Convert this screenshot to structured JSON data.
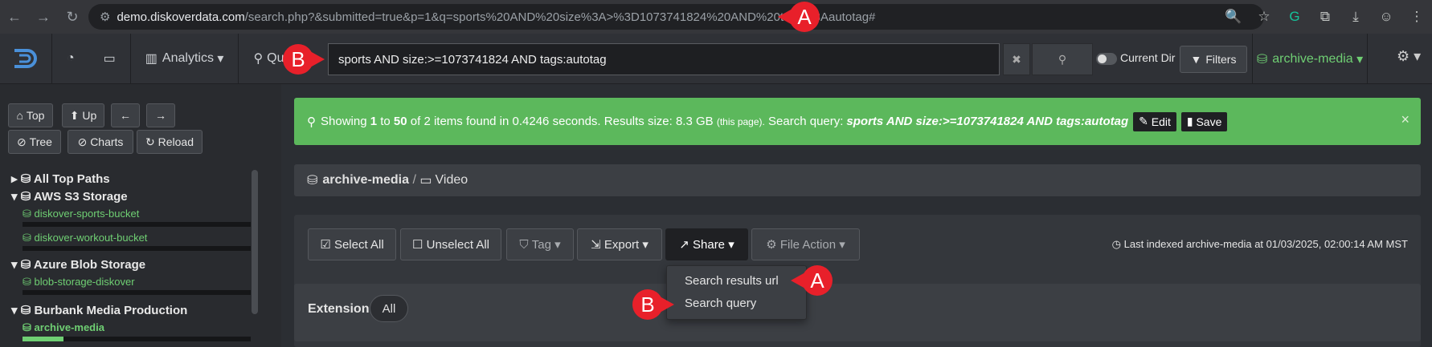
{
  "browser": {
    "url_domain": "demo.diskoverdata.com",
    "url_rest": "/search.php?&submitted=true&p=1&q=sports%20AND%20size%3A>%3D1073741824%20AND%20tags%3Aautotag#"
  },
  "callouts": {
    "a": "A",
    "b": "B"
  },
  "appnav": {
    "analytics": "Analytics",
    "quick_search": "Qu",
    "search_value": "sports AND size:>=1073741824 AND tags:autotag",
    "clear": "✖",
    "current_dir": "Current Dir",
    "filters": "Filters",
    "index": "archive-media"
  },
  "sidebar": {
    "top": "Top",
    "up": "Up",
    "tree": "Tree",
    "charts": "Charts",
    "reload": "Reload",
    "tree_items": {
      "all_top_paths": "All Top Paths",
      "aws": "AWS S3 Storage",
      "aws_1": "diskover-sports-bucket",
      "aws_2": "diskover-workout-bucket",
      "azure": "Azure Blob Storage",
      "azure_1": "blob-storage-diskover",
      "burbank": "Burbank Media Production",
      "burbank_1": "archive-media"
    },
    "usage": {
      "aws_1": 0.0,
      "aws_2": 0.0,
      "azure_1": 0.0,
      "burbank_1": 0.18
    }
  },
  "alert": {
    "showing": "Showing",
    "from": "1",
    "to_word": "to",
    "to": "50",
    "of_word": "of 2 items found in 0.4246 seconds. Results size: 8.3 GB",
    "this_page": "(this page).",
    "query_label": "Search query:",
    "query": "sports AND size:>=1073741824 AND tags:autotag",
    "edit": "Edit",
    "save": "Save",
    "close": "×"
  },
  "breadcrumb": {
    "index": "archive-media",
    "sep": "/",
    "folder": "Video"
  },
  "toolbar": {
    "select_all": "Select All",
    "unselect_all": "Unselect All",
    "tag": "Tag",
    "export": "Export",
    "share": "Share",
    "file_action": "File Action",
    "last_indexed": "Last indexed archive-media at 01/03/2025, 02:00:14 AM MST"
  },
  "share_menu": [
    "Search results url",
    "Search query"
  ],
  "extension": {
    "label": "Extension",
    "all": "All"
  },
  "colors": {
    "accent_green": "#6fcf73",
    "alert_green": "#5cb85c",
    "callout_red": "#e8202a"
  }
}
